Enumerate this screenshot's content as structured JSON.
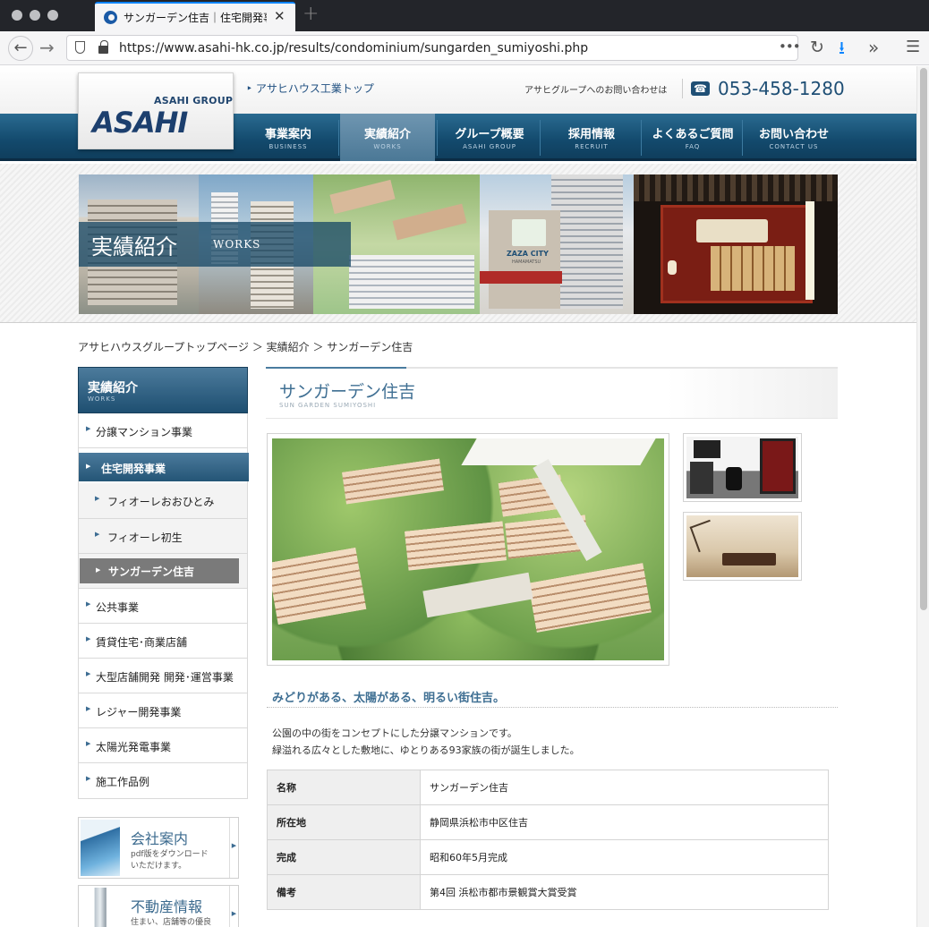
{
  "browser": {
    "tab_title": "サンガーデン住吉｜住宅開発事業",
    "url": "https://www.asahi-hk.co.jp/results/condominium/sungarden_sumiyoshi.php",
    "url_more": "•••"
  },
  "header": {
    "logo_group": "ASAHI GROUP",
    "logo_name": "ASAHI",
    "top_link": "アサヒハウス工業トップ",
    "contact_label": "アサヒグループへのお問い合わせは",
    "phone": "053-458-1280"
  },
  "gnav": [
    {
      "jp": "事業案内",
      "en": "BUSINESS"
    },
    {
      "jp": "実績紹介",
      "en": "WORKS"
    },
    {
      "jp": "グループ概要",
      "en": "ASAHI GROUP"
    },
    {
      "jp": "採用情報",
      "en": "RECRUIT"
    },
    {
      "jp": "よくあるご質問",
      "en": "FAQ"
    },
    {
      "jp": "お問い合わせ",
      "en": "CONTACT US"
    }
  ],
  "hero": {
    "title": "実績紹介",
    "sub": "WORKS",
    "sign_text": "ZAZA CITY",
    "sign_small": "HAMAMATSU"
  },
  "breadcrumb": "アサヒハウスグループトップページ ＞ 実績紹介 ＞ サンガーデン住吉",
  "sidebar": {
    "head_jp": "実績紹介",
    "head_en": "WORKS",
    "items": [
      {
        "label": "分譲マンション事業"
      },
      {
        "label": "住宅開発事業"
      },
      {
        "label": "フィオーレおおひとみ"
      },
      {
        "label": "フィオーレ初生"
      },
      {
        "label": "サンガーデン住吉"
      },
      {
        "label": "公共事業"
      },
      {
        "label": "賃貸住宅･商業店舗"
      },
      {
        "label": "大型店舗開発 開発･運営事業"
      },
      {
        "label": "レジャー開発事業"
      },
      {
        "label": "太陽光発電事業"
      },
      {
        "label": "施工作品例"
      }
    ],
    "banners": [
      {
        "title": "会社案内",
        "desc1": "pdf版をダウンロード",
        "desc2": "いただけます。"
      },
      {
        "title": "不動産情報",
        "desc1": "住まい、店舗等の優良",
        "desc2": ""
      }
    ]
  },
  "main": {
    "title": "サンガーデン住吉",
    "title_en": "SUN GARDEN SUMIYOSHI",
    "tagline": "みどりがある、太陽がある、明るい街住吉。",
    "desc1": "公園の中の街をコンセプトにした分譲マンションです。",
    "desc2": "緑溢れる広々とした敷地に、ゆとりある93家族の街が誕生しました。",
    "table": [
      {
        "k": "名称",
        "v": "サンガーデン住吉"
      },
      {
        "k": "所在地",
        "v": "静岡県浜松市中区住吉"
      },
      {
        "k": "完成",
        "v": "昭和60年5月完成"
      },
      {
        "k": "備考",
        "v": "第4回 浜松市都市景観賞大賞受賞"
      }
    ]
  },
  "colors": {
    "brand": "#1f4f75",
    "nav": "#134a6d",
    "accent": "#3f6f93"
  }
}
